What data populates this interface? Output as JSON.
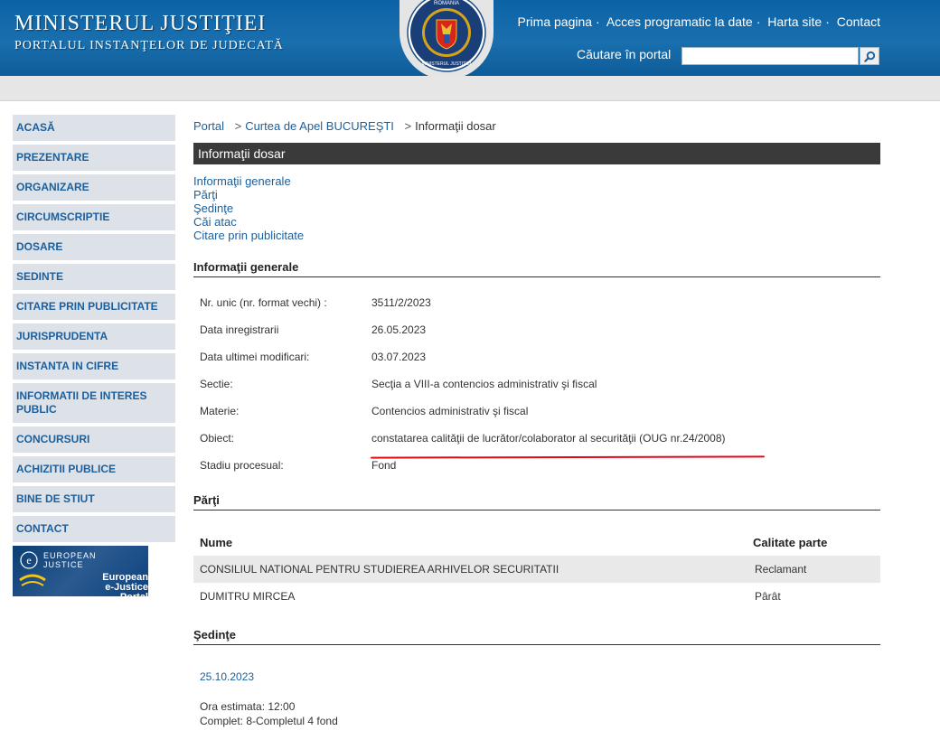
{
  "header": {
    "title": "MINISTERUL JUSTIŢIEI",
    "subtitle": "PORTALUL INSTANŢELOR DE JUDECATĂ",
    "emblem_text_top": "ROMANIA",
    "emblem_text_bottom": "MINISTERUL JUSTIŢIEI",
    "links": [
      "Prima pagina",
      "Acces programatic la date",
      "Harta site",
      "Contact"
    ],
    "search_label": "Căutare în portal",
    "search_placeholder": ""
  },
  "sidebar": {
    "items": [
      "ACASĂ",
      "PREZENTARE",
      "ORGANIZARE",
      "CIRCUMSCRIPTIE",
      "DOSARE",
      "SEDINTE",
      "CITARE PRIN PUBLICITATE",
      "JURISPRUDENTA",
      "INSTANTA IN CIFRE",
      "INFORMATII DE INTERES PUBLIC",
      "CONCURSURI",
      "ACHIZITII PUBLICE",
      "BINE DE STIUT",
      "CONTACT"
    ],
    "ejustice": {
      "line1": "EUROPEAN",
      "line2": "JUSTICE",
      "line3": "European",
      "line4": "e-Justice Portal"
    }
  },
  "breadcrumb": {
    "items": [
      "Portal",
      "Curtea de Apel BUCUREŞTI",
      "Informaţii dosar"
    ],
    "sep": ">"
  },
  "page": {
    "title": "Informaţii dosar",
    "sub_links": [
      "Informaţii generale",
      "Părţi",
      "Şedinţe",
      "Căi atac",
      "Citare prin publicitate"
    ]
  },
  "general": {
    "section_title": "Informaţii generale",
    "rows": [
      {
        "label": "Nr. unic (nr. format vechi) :",
        "value": "3511/2/2023"
      },
      {
        "label": "Data inregistrarii",
        "value": "26.05.2023"
      },
      {
        "label": "Data ultimei modificari:",
        "value": "03.07.2023"
      },
      {
        "label": "Sectie:",
        "value": "Secţia a VIII-a contencios administrativ şi fiscal"
      },
      {
        "label": "Materie:",
        "value": "Contencios administrativ şi fiscal"
      },
      {
        "label": "Obiect:",
        "value": "constatarea calităţii de lucrător/colaborator al securităţii (OUG nr.24/2008)"
      },
      {
        "label": "Stadiu procesual:",
        "value": "Fond"
      }
    ],
    "highlight_color": "#e10a19"
  },
  "parti": {
    "section_title": "Părţi",
    "headers": [
      "Nume",
      "Calitate parte"
    ],
    "rows": [
      {
        "nume": "CONSILIUL NATIONAL PENTRU STUDIEREA ARHIVELOR SECURITATII",
        "calitate": "Reclamant"
      },
      {
        "nume": "DUMITRU MIRCEA",
        "calitate": "Pârât"
      }
    ]
  },
  "sedinte": {
    "section_title": "Şedinţe",
    "date": "25.10.2023",
    "ora": "Ora estimata: 12:00",
    "complet": "Complet: 8-Completul 4 fond"
  },
  "colors": {
    "header_blue": "#1a6fae",
    "link_blue": "#1b5f9d",
    "sidebar_bg": "#dde2e8",
    "titlebar_bg": "#3a3a3a"
  }
}
